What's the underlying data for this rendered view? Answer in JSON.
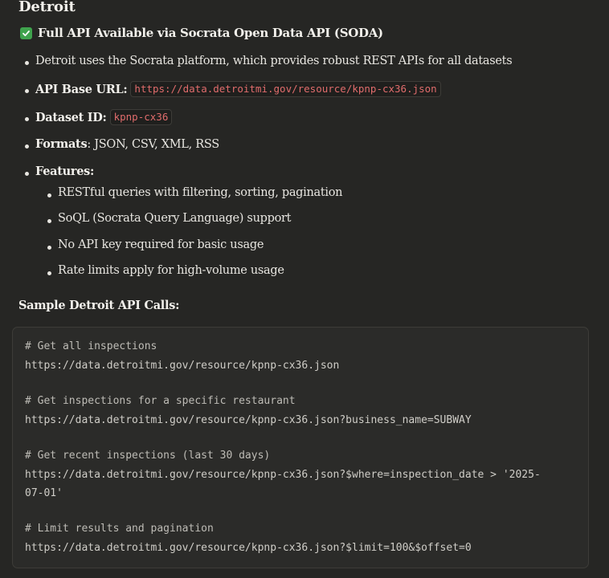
{
  "heading": "Detroit",
  "subheading": "Full API Available via Socrata Open Data API (SODA)",
  "subheading_icon": "check-box-icon",
  "bullets": {
    "platform": "Detroit uses the Socrata platform, which provides robust REST APIs for all datasets",
    "api_base_label": "API Base URL:",
    "api_base_value": "https://data.detroitmi.gov/resource/kpnp-cx36.json",
    "dataset_label": "Dataset ID:",
    "dataset_value": "kpnp-cx36",
    "formats_label": "Formats",
    "formats_value": ": JSON, CSV, XML, RSS",
    "features_label": "Features:",
    "features": [
      "RESTful queries with filtering, sorting, pagination",
      "SoQL (Socrata Query Language) support",
      "No API key required for basic usage",
      "Rate limits apply for high-volume usage"
    ]
  },
  "sample_title": "Sample Detroit API Calls:",
  "code_lines": [
    "# Get all inspections",
    "https://data.detroitmi.gov/resource/kpnp-cx36.json",
    "# Get inspections for a specific restaurant",
    "https://data.detroitmi.gov/resource/kpnp-cx36.json?business_name=SUBWAY",
    "# Get recent inspections (last 30 days)",
    "https://data.detroitmi.gov/resource/kpnp-cx36.json?$where=inspection_date > '2025-",
    "07-01'",
    "# Limit results and pagination",
    "https://data.detroitmi.gov/resource/kpnp-cx36.json?$limit=100&$offset=0"
  ],
  "colors": {
    "background": "#262624",
    "inline_code_text": "#e06c6c",
    "check_green": "#3fa34d"
  }
}
